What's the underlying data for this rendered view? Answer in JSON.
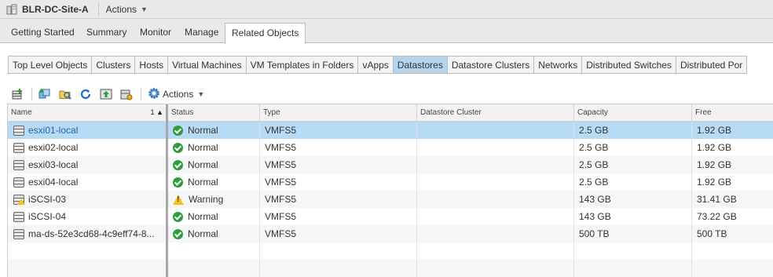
{
  "header": {
    "title": "BLR-DC-Site-A",
    "actions_label": "Actions",
    "icon": "datacenter-icon"
  },
  "main_tabs": [
    {
      "label": "Getting Started"
    },
    {
      "label": "Summary"
    },
    {
      "label": "Monitor"
    },
    {
      "label": "Manage"
    },
    {
      "label": "Related Objects",
      "active": true
    }
  ],
  "sub_tabs": [
    {
      "label": "Top Level Objects"
    },
    {
      "label": "Clusters"
    },
    {
      "label": "Hosts"
    },
    {
      "label": "Virtual Machines"
    },
    {
      "label": "VM Templates in Folders"
    },
    {
      "label": "vApps"
    },
    {
      "label": "Datastores",
      "active": true
    },
    {
      "label": "Datastore Clusters"
    },
    {
      "label": "Networks"
    },
    {
      "label": "Distributed Switches"
    },
    {
      "label": "Distributed Por"
    }
  ],
  "toolbar": {
    "actions_label": "Actions",
    "icons": [
      "new-datastore-icon",
      "register-vm-icon",
      "browse-files-icon",
      "refresh-icon",
      "increase-capacity-icon",
      "datastore-settings-icon",
      "actions-gear-icon"
    ]
  },
  "table": {
    "columns": {
      "name": "Name",
      "sort_order": "1",
      "status": "Status",
      "type": "Type",
      "datastore_cluster": "Datastore Cluster",
      "capacity": "Capacity",
      "free": "Free"
    },
    "rows": [
      {
        "name": "esxi01-local",
        "status": "Normal",
        "type": "VMFS5",
        "cluster": "",
        "capacity": "2.5  GB",
        "free": "1.92  GB",
        "selected": true
      },
      {
        "name": "esxi02-local",
        "status": "Normal",
        "type": "VMFS5",
        "cluster": "",
        "capacity": "2.5  GB",
        "free": "1.92  GB"
      },
      {
        "name": "esxi03-local",
        "status": "Normal",
        "type": "VMFS5",
        "cluster": "",
        "capacity": "2.5  GB",
        "free": "1.92  GB"
      },
      {
        "name": "esxi04-local",
        "status": "Normal",
        "type": "VMFS5",
        "cluster": "",
        "capacity": "2.5  GB",
        "free": "1.92  GB"
      },
      {
        "name": "iSCSI-03",
        "status": "Warning",
        "type": "VMFS5",
        "cluster": "",
        "capacity": "143  GB",
        "free": "31.41  GB"
      },
      {
        "name": "iSCSI-04",
        "status": "Normal",
        "type": "VMFS5",
        "cluster": "",
        "capacity": "143  GB",
        "free": "73.22  GB"
      },
      {
        "name": "ma-ds-52e3cd68-4c9eff74-8...",
        "status": "Normal",
        "type": "VMFS5",
        "cluster": "",
        "capacity": "500  TB",
        "free": "500  TB"
      }
    ]
  },
  "colors": {
    "selected_row": "#b8dbf5",
    "active_subtab": "#b5d5ee",
    "status_ok": "#2e9d3c",
    "status_warning": "#f3c21b"
  }
}
